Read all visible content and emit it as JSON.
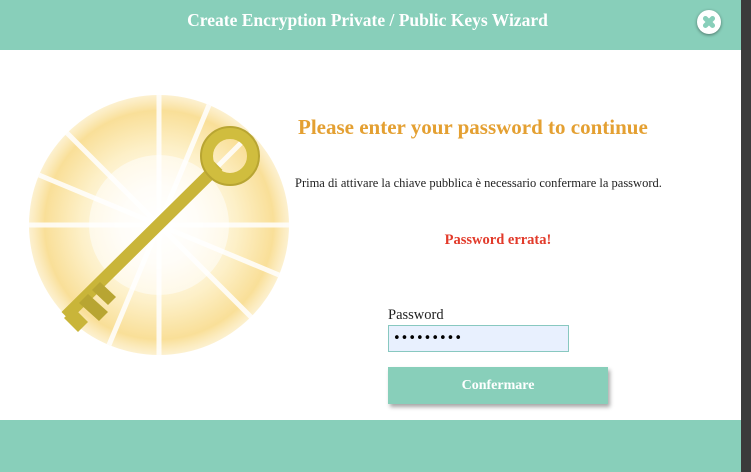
{
  "window": {
    "title": "Create Encryption Private / Public Keys Wizard",
    "close_icon": "close-icon"
  },
  "illustration": {
    "icon": "glowing-key-icon"
  },
  "main": {
    "heading": "Please enter your password to continue",
    "description": "Prima di attivare la chiave pubblica è necessario confermare la password.",
    "error": "Password errata!",
    "password_label": "Password",
    "password_value": "•••••••••",
    "confirm_label": "Confermare"
  },
  "colors": {
    "accent": "#88cfba",
    "heading": "#e4a032",
    "error": "#e23a2a",
    "input_bg": "#e8f0fe"
  }
}
